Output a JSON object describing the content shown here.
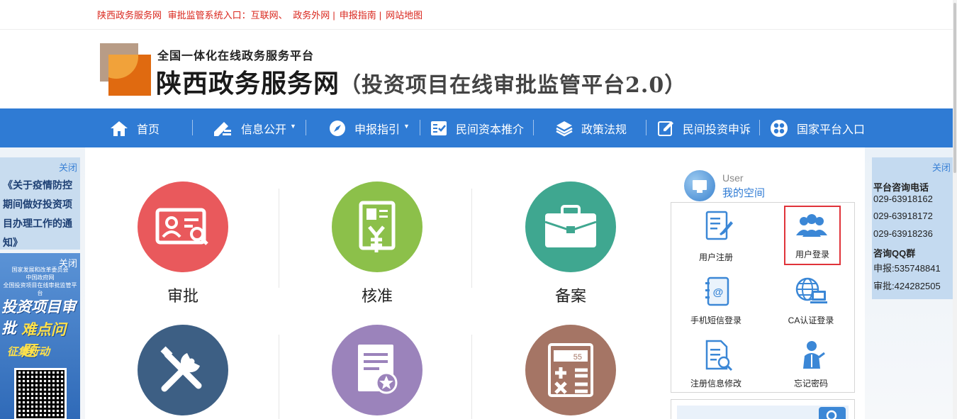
{
  "topbar": {
    "site_name": "陕西政务服务网",
    "entry_label": "审批监管系统入口：",
    "internet_link": "互联网、",
    "extranet_link": "政务外网",
    "guide_link": "申报指南",
    "sitemap_link": "网站地图",
    "separator": "|"
  },
  "header": {
    "tagline": "全国一体化在线政务服务平台",
    "title": "陕西政务服务网",
    "subtitle": "（投资项目在线审批监管平台2.0）"
  },
  "nav": {
    "items": [
      {
        "label": "首页",
        "icon": "home-icon"
      },
      {
        "label": "信息公开",
        "icon": "edit-icon",
        "caret": "▼"
      },
      {
        "label": "申报指引",
        "icon": "compass-icon",
        "caret": "▼"
      },
      {
        "label": "民间资本推介",
        "icon": "checklist-icon"
      },
      {
        "label": "政策法规",
        "icon": "layers-icon"
      },
      {
        "label": "民间投资申诉",
        "icon": "pencil-square-icon"
      },
      {
        "label": "国家平台入口",
        "icon": "grid-circle-icon"
      }
    ]
  },
  "left_ads": {
    "ad1": {
      "close": "关闭",
      "text": "《关于疫情防控期间做好投资项目办理工作的通知》"
    },
    "ad2": {
      "close": "关闭",
      "org_line1": "国家发展和改革委员会",
      "org_line2": "中国政府网",
      "org_line3": "全国投资项目在线审批监管平台",
      "slogan1": "投资项目审批",
      "slogan2": "难点问题",
      "slogan3": "征集行动"
    }
  },
  "right_ad": {
    "close": "关闭",
    "phone_title": "平台咨询电话",
    "phones": [
      "029-63918162",
      "029-63918172",
      "029-63918236"
    ],
    "qq_title": "咨询QQ群",
    "qq_declare": "申报:535748841",
    "qq_approve": "审批:424282505"
  },
  "services": {
    "items": [
      {
        "label": "审批",
        "color": "#e9595c",
        "icon": "id-card-icon"
      },
      {
        "label": "核准",
        "color": "#8cc04a",
        "icon": "yuan-document-icon"
      },
      {
        "label": "备案",
        "color": "#3fa790",
        "icon": "briefcase-icon"
      },
      {
        "label": "",
        "color": "#3d5f84",
        "icon": "tools-icon"
      },
      {
        "label": "",
        "color": "#9b83bb",
        "icon": "certificate-icon"
      },
      {
        "label": "",
        "color": "#a57565",
        "icon": "calculator-icon"
      }
    ],
    "calc_display": "55"
  },
  "user_space": {
    "en_label": "User",
    "cn_label": "我的空间",
    "buttons": [
      {
        "label": "用户注册",
        "icon": "register-form-icon"
      },
      {
        "label": "用户登录",
        "icon": "users-icon",
        "active": true
      },
      {
        "label": "手机短信登录",
        "icon": "phone-book-icon"
      },
      {
        "label": "CA认证登录",
        "icon": "globe-computer-icon"
      },
      {
        "label": "注册信息修改",
        "icon": "document-search-icon"
      },
      {
        "label": "忘记密码",
        "icon": "person-help-icon"
      }
    ]
  },
  "colors": {
    "nav_bg": "#2f7bd4",
    "topbar_link": "#d9261c",
    "active_border": "#e0333a",
    "link_blue": "#2f7bd4"
  }
}
